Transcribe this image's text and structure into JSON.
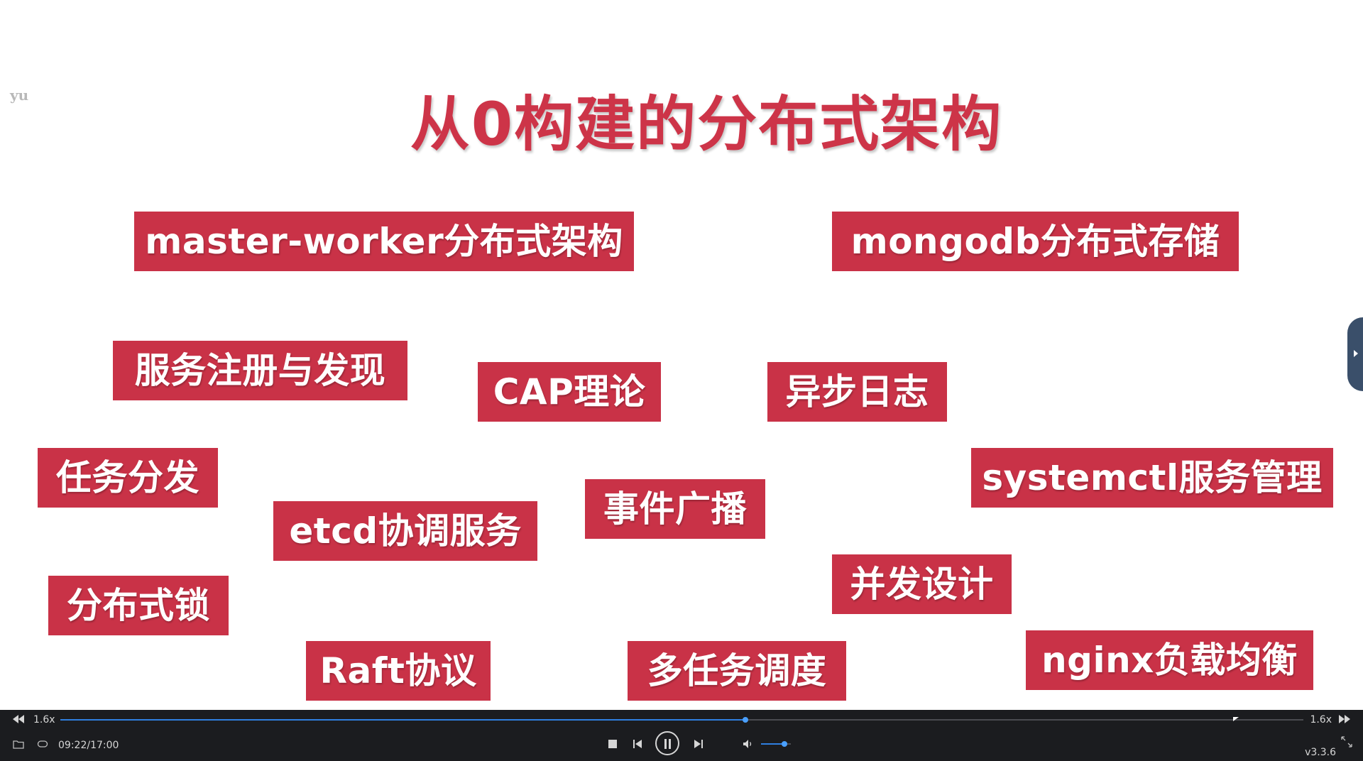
{
  "slide": {
    "watermark": "yu",
    "title": "从0构建的分布式架构",
    "tags": [
      {
        "id": "tag-master-worker",
        "label": "master-worker分布式架构"
      },
      {
        "id": "tag-mongodb",
        "label": "mongodb分布式存储"
      },
      {
        "id": "tag-service-discovery",
        "label": "服务注册与发现"
      },
      {
        "id": "tag-cap",
        "label": "CAP理论"
      },
      {
        "id": "tag-async-log",
        "label": "异步日志"
      },
      {
        "id": "tag-task-dispatch",
        "label": "任务分发"
      },
      {
        "id": "tag-systemctl",
        "label": "systemctl服务管理"
      },
      {
        "id": "tag-event-broadcast",
        "label": "事件广播"
      },
      {
        "id": "tag-etcd",
        "label": "etcd协调服务"
      },
      {
        "id": "tag-concurrency",
        "label": "并发设计"
      },
      {
        "id": "tag-distributed-lock",
        "label": "分布式锁"
      },
      {
        "id": "tag-raft",
        "label": "Raft协议"
      },
      {
        "id": "tag-multitask",
        "label": "多任务调度"
      },
      {
        "id": "tag-nginx",
        "label": "nginx负载均衡"
      }
    ],
    "colors": {
      "title": "#cd3448",
      "tag_bg": "#c93247",
      "tag_text": "#ffffff"
    }
  },
  "player": {
    "speed_left": "1.6x",
    "speed_right": "1.6x",
    "time": "09:22/17:00",
    "progress": 0.551,
    "volume": 0.78,
    "version": "v3.3.6",
    "icons": [
      "rewind-icon",
      "fast-forward-icon",
      "folder-icon",
      "loop-icon",
      "stop-icon",
      "previous-icon",
      "pause-icon",
      "next-icon",
      "volume-icon",
      "fullscreen-icon"
    ]
  }
}
